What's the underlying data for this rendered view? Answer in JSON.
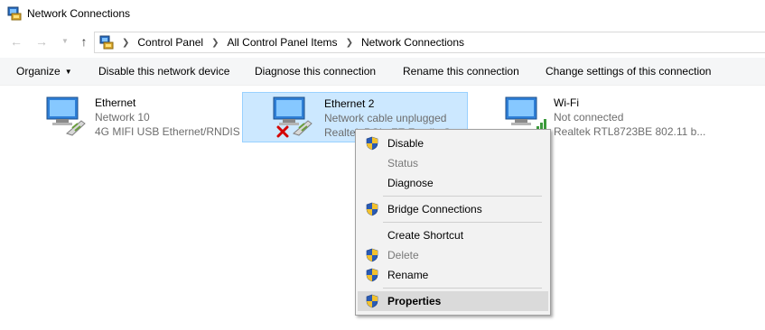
{
  "window": {
    "title": "Network Connections"
  },
  "address": {
    "crumbs": [
      "Control Panel",
      "All Control Panel Items",
      "Network Connections"
    ]
  },
  "commands": {
    "organize": "Organize",
    "disable": "Disable this network device",
    "diagnose": "Diagnose this connection",
    "rename": "Rename this connection",
    "change": "Change settings of this connection"
  },
  "connections": [
    {
      "name": "Ethernet",
      "status": "Network 10",
      "adapter": "4G MIFI USB Ethernet/RNDIS",
      "icon": "ethernet-icon"
    },
    {
      "name": "Ethernet 2",
      "status": "Network cable unplugged",
      "adapter": "Realtek PCIe FE Family Co...",
      "icon": "ethernet-disconnected-icon",
      "selected": true
    },
    {
      "name": "Wi-Fi",
      "status": "Not connected",
      "adapter": "Realtek RTL8723BE 802.11 b...",
      "icon": "wifi-disconnected-icon"
    }
  ],
  "context_menu": {
    "items": [
      {
        "label": "Disable",
        "shield": true,
        "disabled": false
      },
      {
        "label": "Status",
        "shield": false,
        "disabled": true
      },
      {
        "label": "Diagnose",
        "shield": false,
        "disabled": false
      },
      {
        "label": "Bridge Connections",
        "shield": true,
        "disabled": false
      },
      {
        "label": "Create Shortcut",
        "shield": false,
        "disabled": false
      },
      {
        "label": "Delete",
        "shield": true,
        "disabled": true
      },
      {
        "label": "Rename",
        "shield": true,
        "disabled": false
      },
      {
        "label": "Properties",
        "shield": true,
        "disabled": false,
        "bold": true,
        "hover": true
      }
    ]
  },
  "colors": {
    "selection_bg": "#cce8ff",
    "selection_border": "#99d1ff",
    "menu_bg": "#f2f2f2",
    "menu_hover": "#dadada"
  }
}
